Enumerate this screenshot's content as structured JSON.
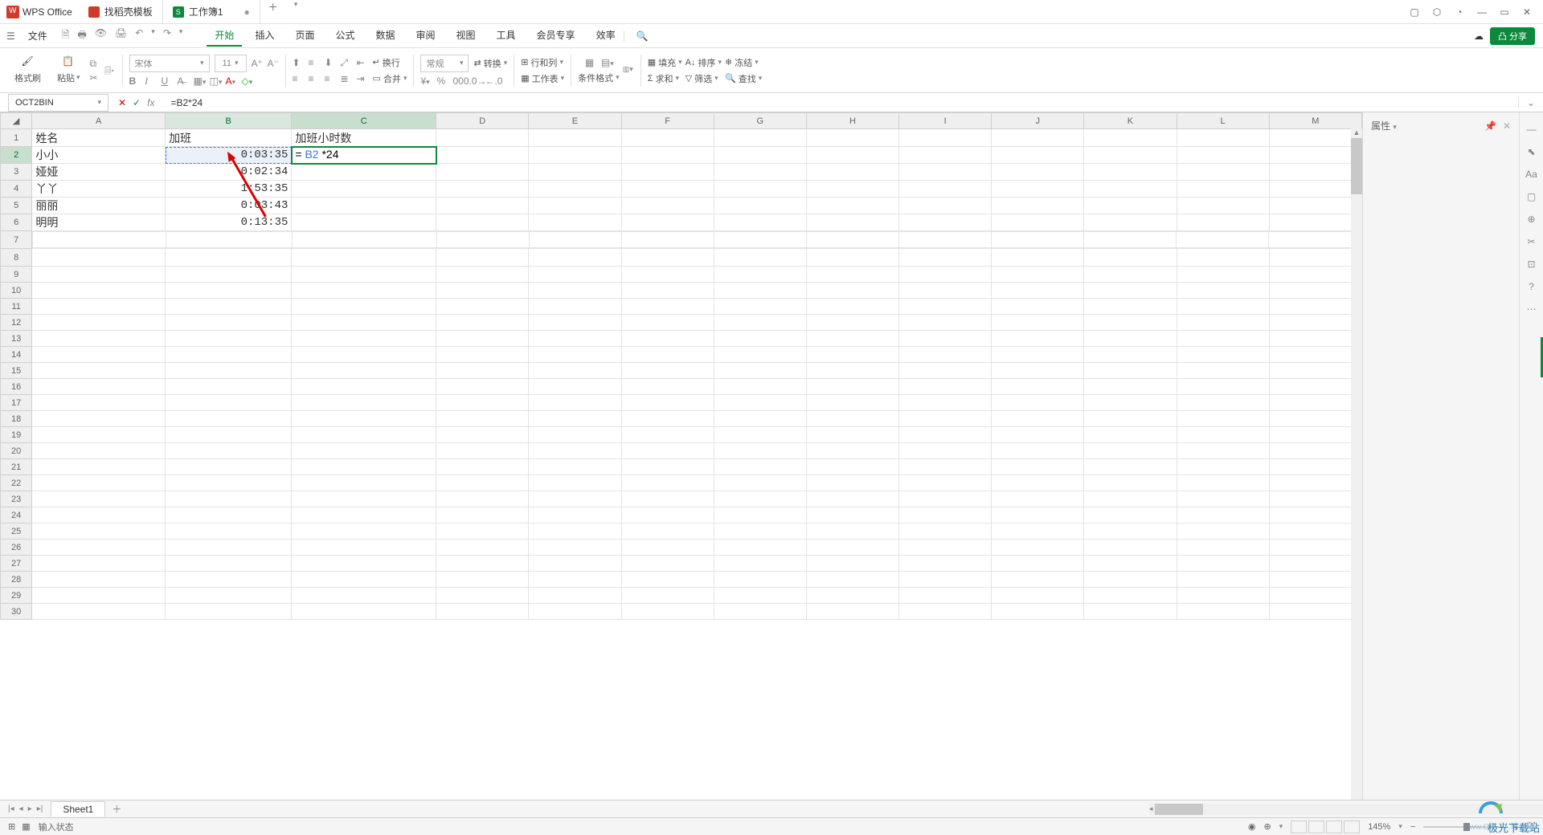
{
  "app": {
    "name": "WPS Office"
  },
  "tabs": [
    {
      "label": "找稻壳模板",
      "icon": "d"
    },
    {
      "label": "工作簿1",
      "icon": "s",
      "dirty": "●"
    }
  ],
  "menu": {
    "file": "文件",
    "items": [
      "开始",
      "插入",
      "页面",
      "公式",
      "数据",
      "审阅",
      "视图",
      "工具",
      "会员专享",
      "效率"
    ],
    "active_index": 0,
    "share": "分享"
  },
  "ribbon": {
    "format_painter": "格式刷",
    "paste": "粘贴",
    "font_name": "宋体",
    "font_size": "11",
    "general": "常规",
    "convert": "转换",
    "rows_cols": "行和列",
    "worksheet": "工作表",
    "cond_format": "条件格式",
    "fill": "填充",
    "sort": "排序",
    "freeze": "冻结",
    "sum": "求和",
    "filter": "筛选",
    "find": "查找",
    "merge": "合并",
    "wrap": "换行"
  },
  "formula_bar": {
    "name_box": "OCT2BIN",
    "formula": "=B2*24"
  },
  "props": {
    "title": "属性"
  },
  "columns": [
    "A",
    "B",
    "C",
    "D",
    "E",
    "F",
    "G",
    "H",
    "I",
    "J",
    "K",
    "L",
    "M"
  ],
  "rows_count": 30,
  "data": {
    "headers": {
      "a": "姓名",
      "b": "加班",
      "c": "加班小时数"
    },
    "rows": [
      {
        "name": "小小",
        "time": "0:03:35",
        "formula_display": "= B2 *24"
      },
      {
        "name": "娅娅",
        "time": "0:02:34"
      },
      {
        "name": "丫丫",
        "time": "1:53:35"
      },
      {
        "name": "丽丽",
        "time": "0:03:43"
      },
      {
        "name": "明明",
        "time": "0:13:35"
      }
    ]
  },
  "sheet_tab": "Sheet1",
  "status": {
    "mode": "输入状态",
    "zoom": "145%"
  },
  "watermark": "www.OH- 办.笔.所不",
  "watermark_brand": "极光下载站"
}
